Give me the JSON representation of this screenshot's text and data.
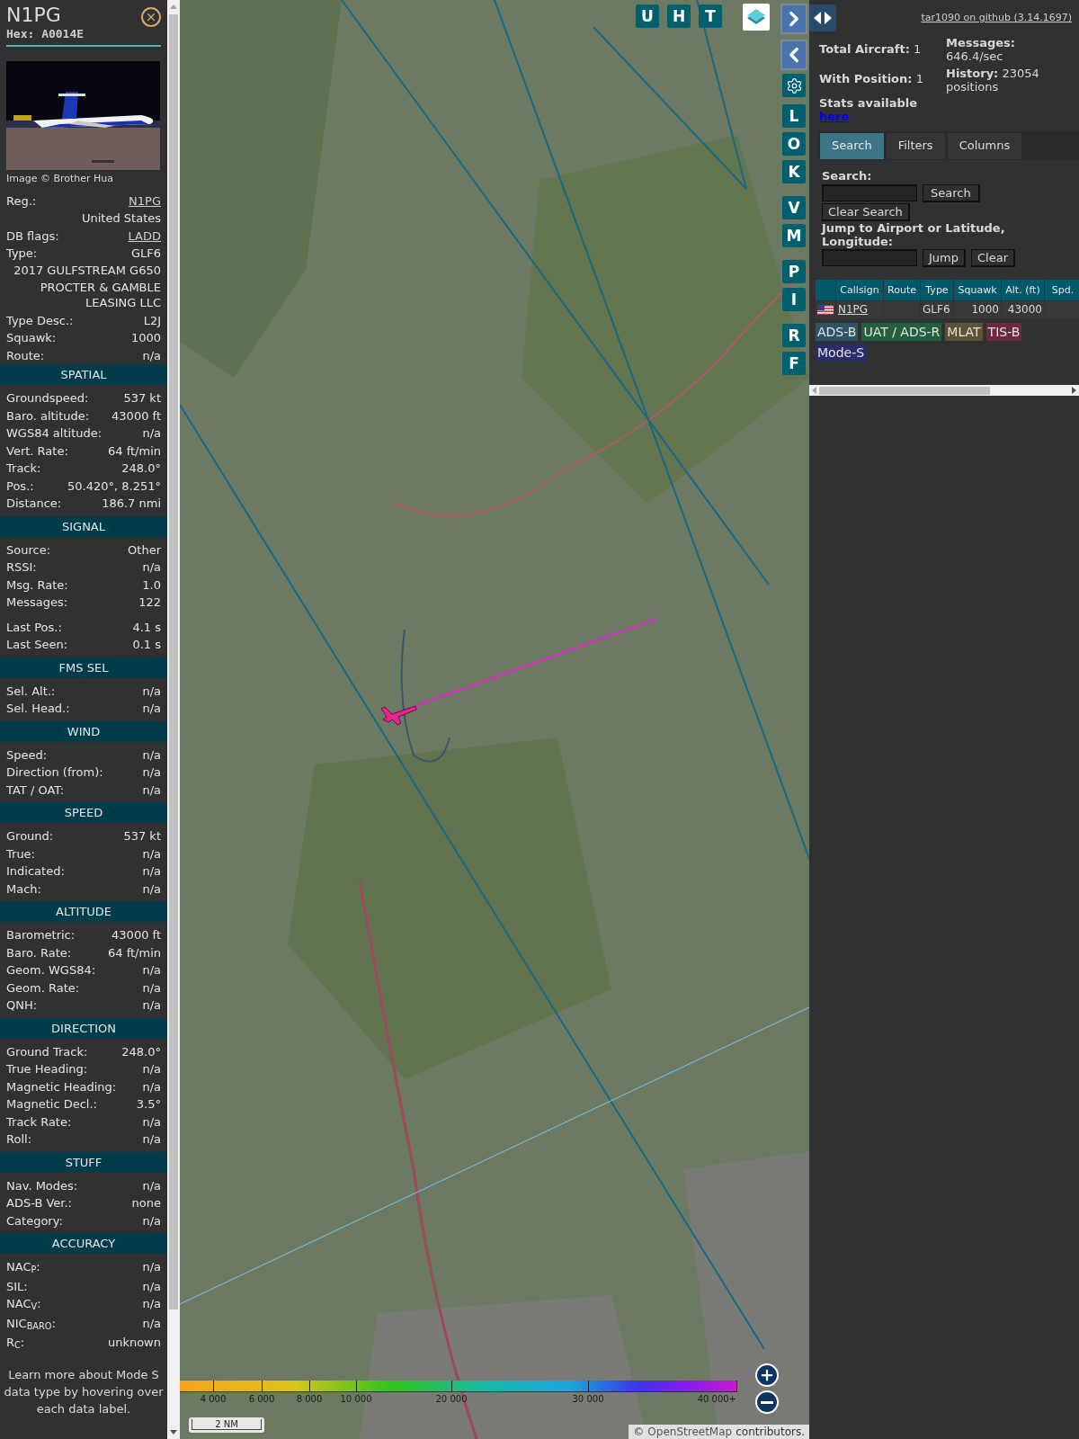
{
  "aircraft": {
    "callsign": "N1PG",
    "hex": "Hex: A0014E",
    "photo_credit": "Image © Brother Hua"
  },
  "summary": [
    {
      "kind": "link",
      "label": "Reg.:",
      "value": "N1PG"
    },
    {
      "kind": "value",
      "value": "United States"
    },
    {
      "kind": "link",
      "label": "DB flags:",
      "value": "LADD"
    },
    {
      "kind": "pair",
      "label": "Type:",
      "value": "GLF6"
    },
    {
      "kind": "value",
      "value": "2017 GULFSTREAM G650"
    },
    {
      "kind": "value",
      "value": "PROCTER & GAMBLE LEASING LLC"
    },
    {
      "kind": "pair",
      "label": "Type Desc.:",
      "value": "L2J"
    },
    {
      "kind": "pair",
      "label": "Squawk:",
      "value": "1000"
    },
    {
      "kind": "pair",
      "label": "Route:",
      "value": "n/a"
    }
  ],
  "sections": [
    {
      "title": "SPATIAL",
      "groups": [
        [
          {
            "label": "Groundspeed:",
            "value": "537 kt"
          },
          {
            "label": "Baro. altitude:",
            "value": "43000 ft"
          },
          {
            "label": "WGS84 altitude:",
            "value": "n/a"
          },
          {
            "label": "Vert. Rate:",
            "value": "64 ft/min"
          },
          {
            "label": "Track:",
            "value": "248.0°"
          },
          {
            "label": "Pos.:",
            "value": "50.420°, 8.251°"
          },
          {
            "label": "Distance:",
            "value": "186.7 nmi"
          }
        ]
      ]
    },
    {
      "title": "SIGNAL",
      "groups": [
        [
          {
            "label": "Source:",
            "value": "Other"
          },
          {
            "label": "RSSI:",
            "value": "n/a"
          },
          {
            "label": "Msg. Rate:",
            "value": "1.0"
          },
          {
            "label": "Messages:",
            "value": "122"
          }
        ],
        [
          {
            "label": "Last Pos.:",
            "value": "4.1 s"
          },
          {
            "label": "Last Seen:",
            "value": "0.1 s"
          }
        ]
      ]
    },
    {
      "title": "FMS SEL",
      "groups": [
        [
          {
            "label": "Sel. Alt.:",
            "value": "n/a"
          },
          {
            "label": "Sel. Head.:",
            "value": "n/a"
          }
        ]
      ]
    },
    {
      "title": "WIND",
      "groups": [
        [
          {
            "label": "Speed:",
            "value": "n/a"
          },
          {
            "label": "Direction (from):",
            "value": "n/a"
          },
          {
            "label": "TAT / OAT:",
            "value": "n/a"
          }
        ]
      ]
    },
    {
      "title": "SPEED",
      "groups": [
        [
          {
            "label": "Ground:",
            "value": "537 kt"
          },
          {
            "label": "True:",
            "value": "n/a"
          },
          {
            "label": "Indicated:",
            "value": "n/a"
          },
          {
            "label": "Mach:",
            "value": "n/a"
          }
        ]
      ]
    },
    {
      "title": "ALTITUDE",
      "groups": [
        [
          {
            "label": "Barometric:",
            "value": "43000 ft"
          },
          {
            "label": "Baro. Rate:",
            "value": "64 ft/min"
          },
          {
            "label": "Geom. WGS84:",
            "value": "n/a"
          },
          {
            "label": "Geom. Rate:",
            "value": "n/a"
          },
          {
            "label": "QNH:",
            "value": "n/a"
          }
        ]
      ]
    },
    {
      "title": "DIRECTION",
      "groups": [
        [
          {
            "label": "Ground Track:",
            "value": "248.0°"
          },
          {
            "label": "True Heading:",
            "value": "n/a"
          },
          {
            "label": "Magnetic Heading:",
            "value": "n/a"
          },
          {
            "label": "Magnetic Decl.:",
            "value": "3.5°"
          },
          {
            "label": "Track Rate:",
            "value": "n/a"
          },
          {
            "label": "Roll:",
            "value": "n/a"
          }
        ]
      ]
    },
    {
      "title": "STUFF",
      "groups": [
        [
          {
            "label": "Nav. Modes:",
            "value": "n/a"
          },
          {
            "label": "ADS-B Ver.:",
            "value": "none"
          },
          {
            "label": "Category:",
            "value": "n/a"
          }
        ]
      ]
    },
    {
      "title": "ACCURACY",
      "groups": [
        [
          {
            "label": "NAC$_{P}$:",
            "value": "n/a"
          },
          {
            "label": "SIL:",
            "value": "n/a"
          },
          {
            "label": "NAC$_{V}$:",
            "value": "n/a"
          },
          {
            "label": "NIC$_{BARO}$:",
            "value": "n/a"
          },
          {
            "label": "R$_{C}$:",
            "value": "unknown"
          }
        ]
      ]
    }
  ],
  "note": "Learn more about Mode S data type by hovering over each data label.",
  "map": {
    "kind": "picture",
    "top_buttons": [
      "U",
      "H",
      "T"
    ],
    "side_groups": [
      [
        "L",
        "O",
        "K"
      ],
      [
        "V",
        "M"
      ],
      [
        "P",
        "I"
      ],
      [
        "R",
        "F"
      ]
    ],
    "legend": [
      "4 000",
      "6 000",
      "8 000",
      "10 000",
      "20 000",
      "30 000",
      "40 000+"
    ],
    "scale": "2 NM",
    "attribution": {
      "prefix": "©",
      "link": "OpenStreetMap",
      "suffix": "contributors."
    }
  },
  "panel": {
    "github_link": "tar1090 on github (3.14.1697)",
    "stats_left": [
      "**Total Aircraft:** 1",
      "**With Position:** 1"
    ],
    "stats_right": [
      "**Messages:** 646.4/sec",
      "**History:** 23054 positions"
    ],
    "stats_available": "Stats available",
    "stats_link": "here",
    "tabs": [
      {
        "label": "Search",
        "selected": true
      },
      {
        "label": "Filters",
        "selected": false
      },
      {
        "label": "Columns",
        "selected": false
      }
    ],
    "search_label": "Search:",
    "search_button": "Search",
    "clear_search_button": "Clear Search",
    "jump_label": "Jump to Airport or Latitude, Longitude:",
    "jump_button": "Jump",
    "clear_button": "Clear",
    "table": {
      "columns": [
        "Callsign",
        "Route",
        "Type",
        "Squawk",
        "Alt. (ft)",
        "Spd."
      ],
      "rows": [
        {
          "cells": [
            "N1PG",
            null,
            "GLF6",
            "1000",
            "43000",
            null
          ]
        }
      ]
    },
    "sources": [
      {
        "label": "ADS-B",
        "color": "#2c5466"
      },
      {
        "label": "UAT / ADS-R",
        "color": "#235e3d"
      },
      {
        "label": "MLAT",
        "color": "#5c5330"
      },
      {
        "label": "TIS-B",
        "color": "#6b2a3c"
      },
      {
        "label": "Mode-S",
        "color": "#2c2b6a"
      }
    ]
  }
}
